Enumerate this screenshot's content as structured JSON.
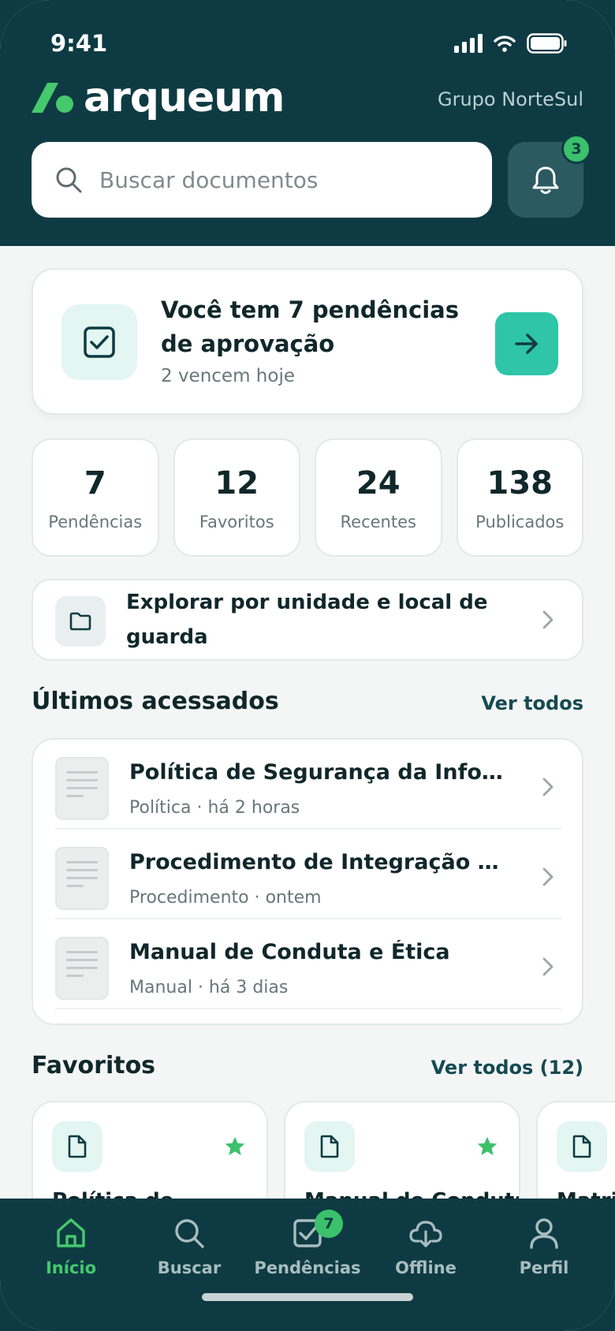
{
  "status_bar": {
    "time": "9:41"
  },
  "brand": {
    "name": "arqueum",
    "org": "Grupo NorteSul"
  },
  "search": {
    "placeholder": "Buscar documentos"
  },
  "notifications": {
    "count": "3"
  },
  "pending": {
    "title": "Você tem 7 pendências de aprovação",
    "subtitle": "2 vencem hoje"
  },
  "stats": [
    {
      "value": "7",
      "label": "Pendências"
    },
    {
      "value": "12",
      "label": "Favoritos"
    },
    {
      "value": "24",
      "label": "Recentes"
    },
    {
      "value": "138",
      "label": "Publicados"
    }
  ],
  "explore": {
    "label": "Explorar por unidade e local de guarda"
  },
  "recent": {
    "title": "Últimos acessados",
    "link": "Ver todos",
    "items": [
      {
        "title": "Política de Segurança da Informação",
        "meta": "Política · há 2 horas"
      },
      {
        "title": "Procedimento de Integração de Terceiros",
        "meta": "Procedimento · ontem"
      },
      {
        "title": "Manual de Conduta e Ética",
        "meta": "Manual · há 3 dias"
      }
    ]
  },
  "favorites": {
    "title": "Favoritos",
    "link": "Ver todos (12)",
    "items": [
      {
        "title": "Política de"
      },
      {
        "title": "Manual de Conduta"
      },
      {
        "title": "Matriz"
      }
    ]
  },
  "tabbar": {
    "items": [
      {
        "label": "Início",
        "icon": "home-icon"
      },
      {
        "label": "Buscar",
        "icon": "search-icon"
      },
      {
        "label": "Pendências",
        "icon": "checkbox-icon",
        "badge": "7"
      },
      {
        "label": "Offline",
        "icon": "cloud-download-icon"
      },
      {
        "label": "Perfil",
        "icon": "person-icon"
      }
    ]
  },
  "colors": {
    "header_bg": "#0e3b43",
    "accent": "#2ec5a8",
    "badge": "#3bc06b",
    "active_tab": "#45c96d",
    "star": "#3bc06b"
  }
}
